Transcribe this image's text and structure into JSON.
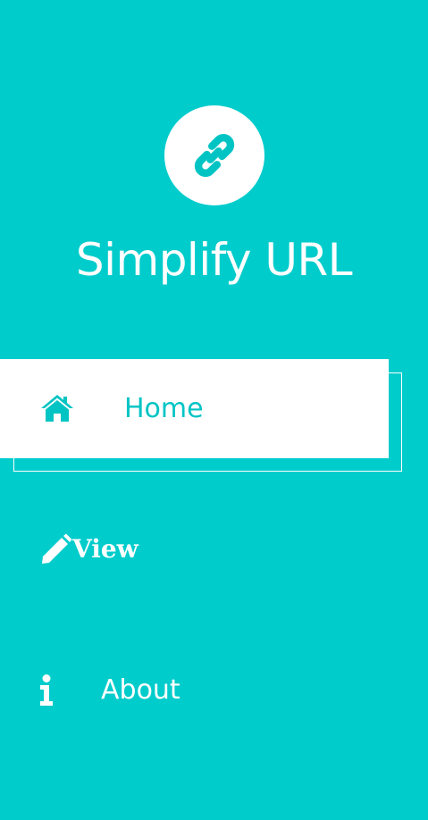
{
  "app": {
    "title": "Simplify URL",
    "logo_icon": "link-icon"
  },
  "colors": {
    "background": "#00cccc",
    "accent": "#00c4c4",
    "surface": "#ffffff"
  },
  "nav": {
    "items": [
      {
        "label": "Home",
        "icon": "home-icon",
        "active": true
      },
      {
        "label": "View",
        "icon": "pencil-icon",
        "active": false
      },
      {
        "label": "About",
        "icon": "info-icon",
        "active": false
      }
    ]
  }
}
